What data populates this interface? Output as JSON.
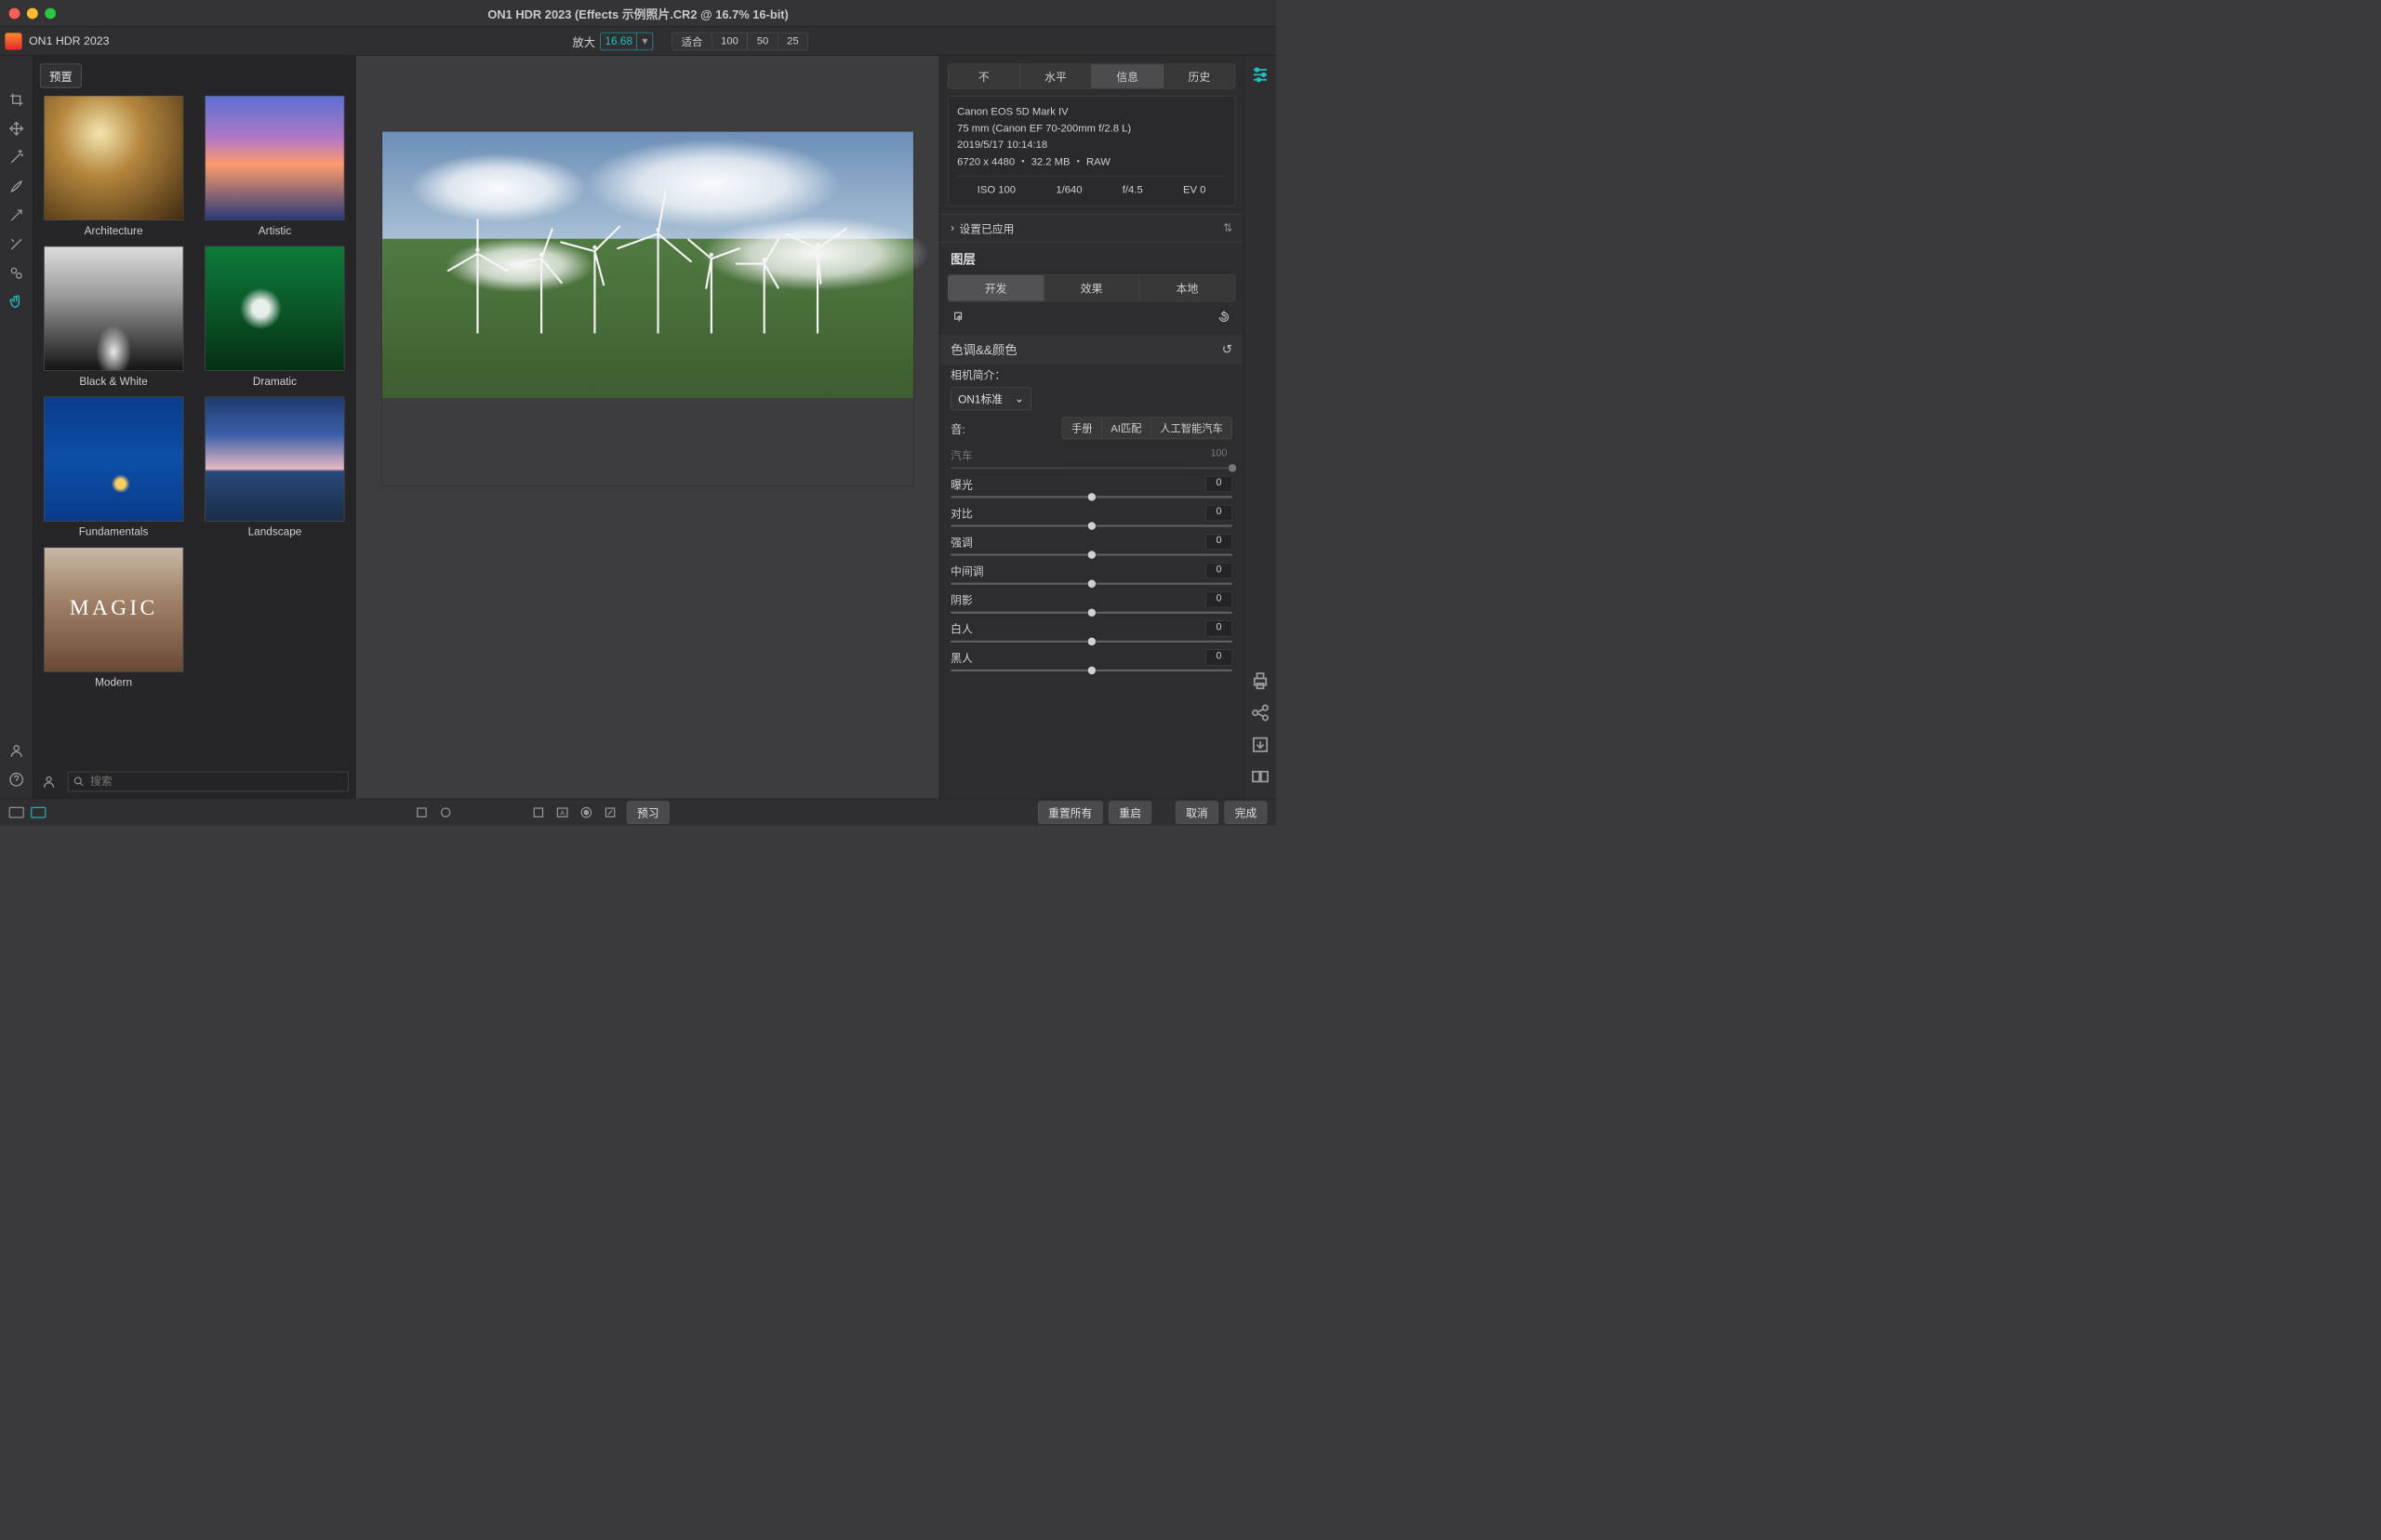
{
  "app": {
    "window_title": "ON1 HDR 2023 (Effects 示例照片.CR2 @ 16.7% 16-bit)",
    "toolbar_title": "ON1 HDR 2023"
  },
  "zoom": {
    "label": "放大",
    "value": "16.68",
    "fit_label": "适合",
    "presets": [
      "100",
      "50",
      "25"
    ]
  },
  "presets": {
    "chip": "预置",
    "items": [
      {
        "label": "Architecture",
        "thumb_class": "th-arch"
      },
      {
        "label": "Artistic",
        "thumb_class": "th-art"
      },
      {
        "label": "Black & White",
        "thumb_class": "th-bw"
      },
      {
        "label": "Dramatic",
        "thumb_class": "th-dram"
      },
      {
        "label": "Fundamentals",
        "thumb_class": "th-fund"
      },
      {
        "label": "Landscape",
        "thumb_class": "th-land"
      },
      {
        "label": "Modern",
        "thumb_class": "th-mod"
      }
    ],
    "search_placeholder": "搜索"
  },
  "right": {
    "tabs": [
      "不",
      "水平",
      "信息",
      "历史"
    ],
    "active_tab": 2,
    "info": {
      "camera": "Canon EOS 5D Mark IV",
      "lens": "75 mm (Canon EF 70-200mm f/2.8 L)",
      "datetime": "2019/5/17  10:14:18",
      "dims_line": "6720 x 4480 ・ 32.2 MB ・ RAW",
      "exif": {
        "iso": "ISO 100",
        "shutter": "1/640",
        "aperture": "f/4.5",
        "ev": "EV 0"
      }
    },
    "settings_applied": "设置已应用",
    "layers_header": "图层",
    "layer_tabs": [
      "开发",
      "效果",
      "本地"
    ],
    "active_layer_tab": 0,
    "tone_header": "色调&&颜色",
    "profile_label": "相机简介：",
    "profile_value": "ON1标准",
    "auto_label": "音:",
    "auto_seg": [
      "手册",
      "AI匹配",
      "人工智能汽车"
    ],
    "sliders": [
      {
        "name": "汽车",
        "value": "100",
        "disabled": true
      },
      {
        "name": "曝光",
        "value": "0"
      },
      {
        "name": "对比",
        "value": "0"
      },
      {
        "name": "强调",
        "value": "0"
      },
      {
        "name": "中间调",
        "value": "0"
      },
      {
        "name": "阴影",
        "value": "0"
      },
      {
        "name": "白人",
        "value": "0"
      },
      {
        "name": "黑人",
        "value": "0"
      }
    ]
  },
  "footer": {
    "preview": "预习",
    "reset_all": "重置所有",
    "restart": "重启",
    "cancel": "取消",
    "done": "完成"
  }
}
